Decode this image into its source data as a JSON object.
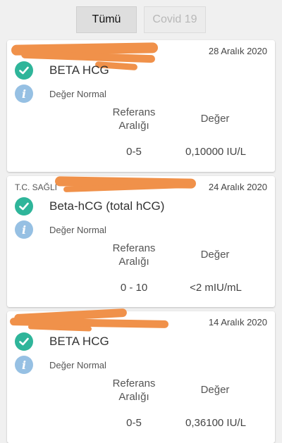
{
  "tabs": [
    {
      "label": "Tümü",
      "active": true
    },
    {
      "label": "Covid 19",
      "active": false
    }
  ],
  "headers": {
    "reference": "Referans Aralığı",
    "value": "Değer"
  },
  "results": [
    {
      "institution": "",
      "date": "28 Aralık 2020",
      "test_name": "BETA HCG",
      "status": "Değer Normal",
      "reference_range": "0-5",
      "value": "0,10000 IU/L"
    },
    {
      "institution": "T.C. SAĞLI",
      "date": "24 Aralık 2020",
      "test_name": "Beta-hCG (total hCG)",
      "status": "Değer Normal",
      "reference_range": "0 - 10",
      "value": "<2 mIU/mL"
    },
    {
      "institution": "",
      "date": "14 Aralık 2020",
      "test_name": "BETA HCG",
      "status": "Değer Normal",
      "reference_range": "0-5",
      "value": "0,36100 IU/L"
    }
  ],
  "colors": {
    "check": "#2fb59a",
    "info": "#96c0e3",
    "redaction": "#f0914a"
  },
  "icons": [
    "check-circle-icon",
    "info-icon"
  ]
}
